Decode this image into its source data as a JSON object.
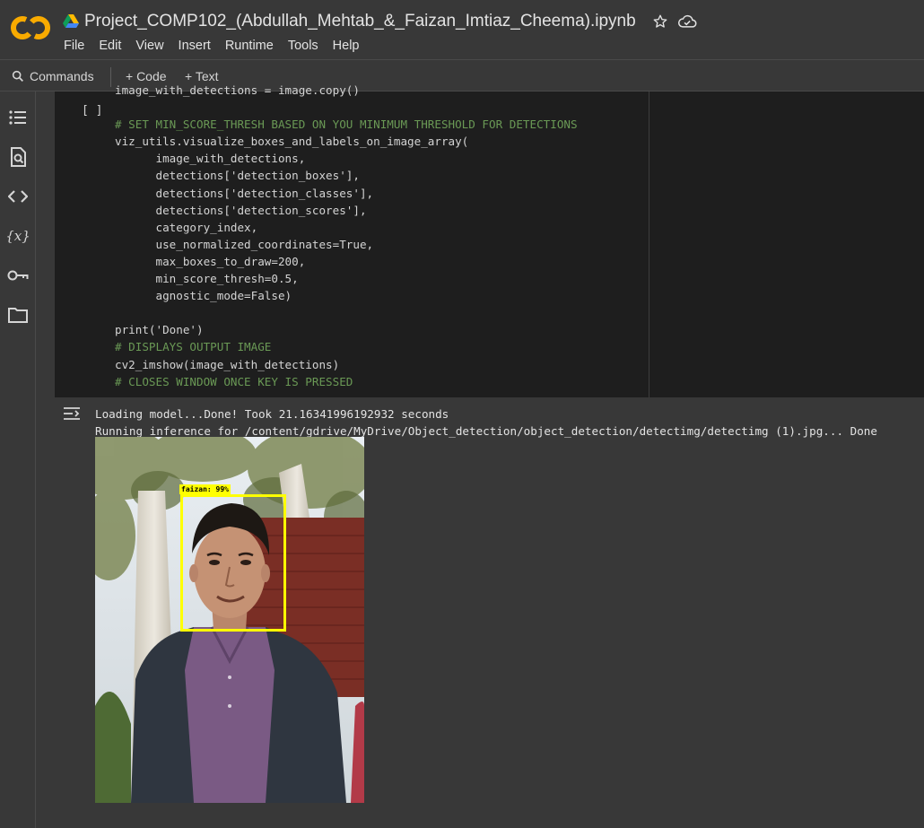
{
  "header": {
    "title": "Project_COMP102_(Abdullah_Mehtab_&_Faizan_Imtiaz_Cheema).ipynb",
    "logo_text": "CO",
    "icons": [
      "drive-icon",
      "star-icon",
      "cloud-icon"
    ]
  },
  "menu": [
    "File",
    "Edit",
    "View",
    "Insert",
    "Runtime",
    "Tools",
    "Help"
  ],
  "toolbar": {
    "commands_label": "Commands",
    "code_label": "+ Code",
    "text_label": "+ Text"
  },
  "sidebar": {
    "icons": [
      "table-of-contents-icon",
      "find-replace-icon",
      "code-snippets-icon",
      "variables-icon",
      "secrets-key-icon",
      "files-folder-icon"
    ]
  },
  "cell": {
    "run_indicator": "[ ]",
    "code_lines": [
      "image_with_detections = image.copy()",
      "",
      "# SET MIN_SCORE_THRESH BASED ON YOU MINIMUM THRESHOLD FOR DETECTIONS",
      "viz_utils.visualize_boxes_and_labels_on_image_array(",
      "      image_with_detections,",
      "      detections['detection_boxes'],",
      "      detections['detection_classes'],",
      "      detections['detection_scores'],",
      "      category_index,",
      "      use_normalized_coordinates=True,",
      "      max_boxes_to_draw=200,",
      "      min_score_thresh=0.5,",
      "      agnostic_mode=False)",
      "",
      "print('Done')",
      "# DISPLAYS OUTPUT IMAGE",
      "cv2_imshow(image_with_detections)",
      "# CLOSES WINDOW ONCE KEY IS PRESSED"
    ]
  },
  "output": {
    "line1": "Loading model...Done! Took 21.16341996192932 seconds",
    "line2": "Running inference for /content/gdrive/MyDrive/Object_detection/object_detection/detectimg/detectimg (1).jpg... Done",
    "detection_label": "faizan: 99%",
    "detection_box_color": "#ffff00"
  },
  "colors": {
    "background": "#383838",
    "code_background": "#1e1e1e",
    "comment": "#6a9955",
    "string": "#ce9178",
    "keyword": "#569cd6",
    "logo_orange": "#f9ab00"
  }
}
